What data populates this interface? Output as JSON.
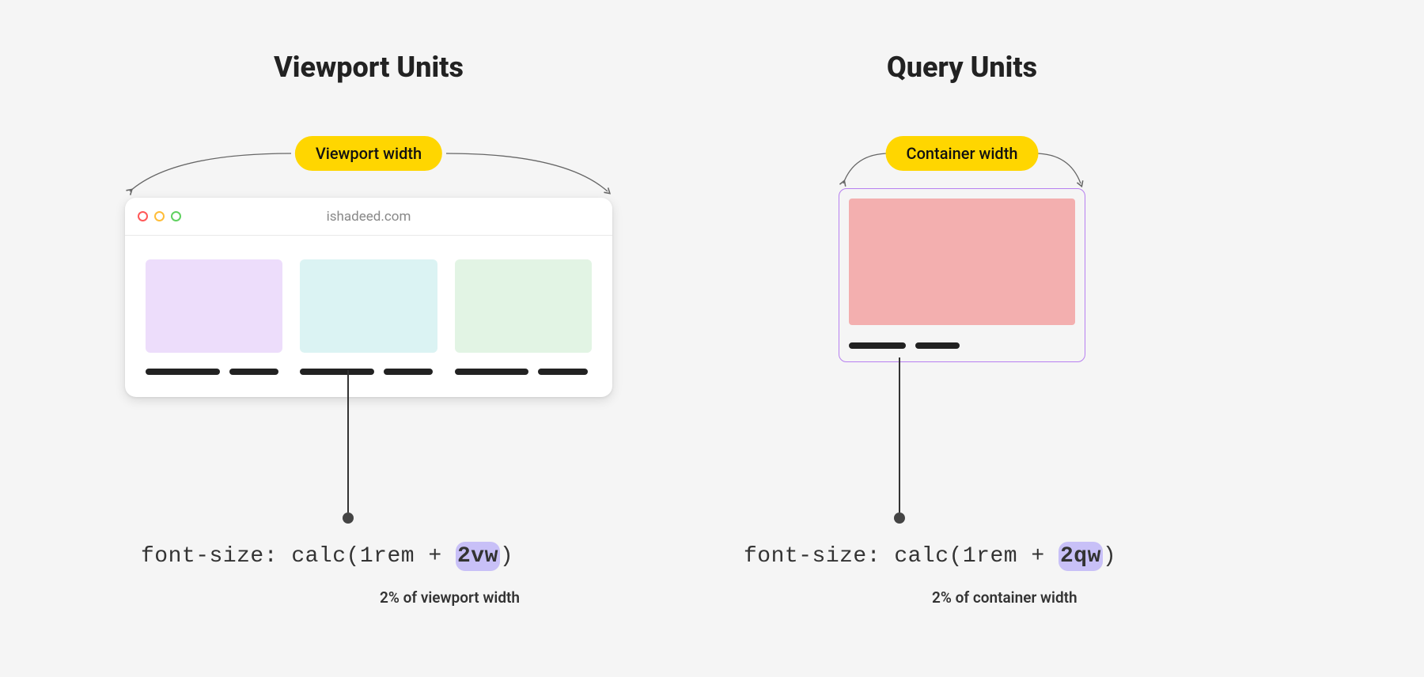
{
  "left_heading": "Viewport Units",
  "right_heading": "Query Units",
  "left_pill": "Viewport width",
  "right_pill": "Container width",
  "browser_url": "ishadeed.com",
  "code_left": {
    "prefix": "font-size: calc(1rem + ",
    "highlighted": "2vw",
    "suffix": ")"
  },
  "code_right": {
    "prefix": "font-size: calc(1rem + ",
    "highlighted": "2qw",
    "suffix": ")"
  },
  "caption_left": "2% of viewport width",
  "caption_right": "2% of container width"
}
